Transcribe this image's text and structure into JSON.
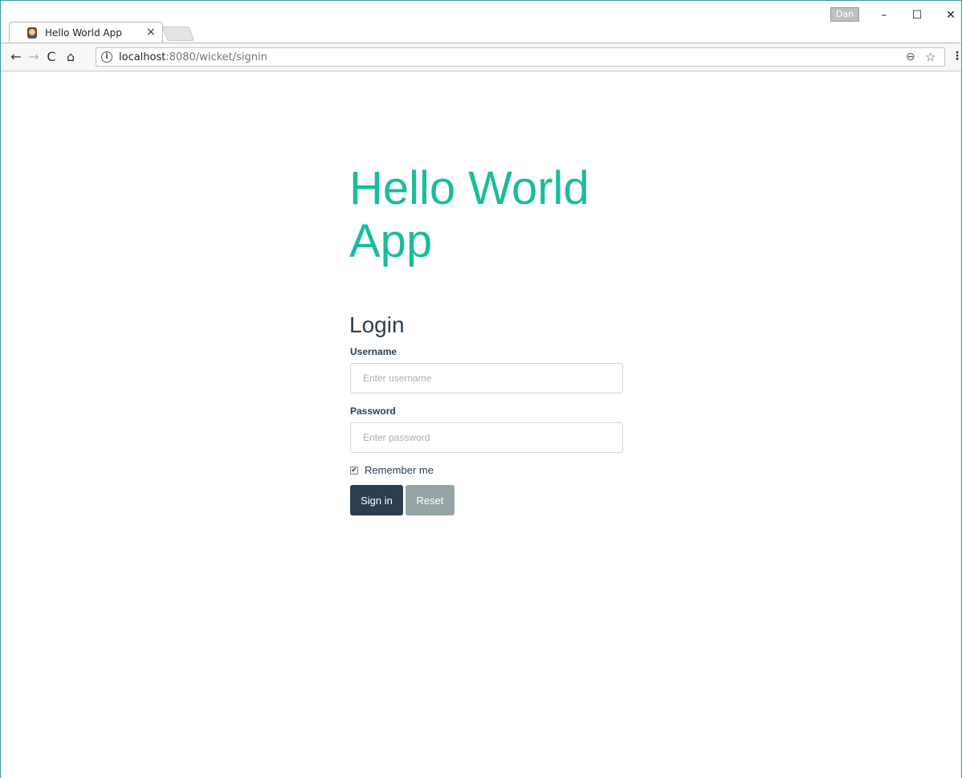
{
  "browser": {
    "tab_title": "Hello World App",
    "tab_close": "×",
    "profile_name": "Dan",
    "window_controls": {
      "minimize": "–",
      "maximize": "☐",
      "close": "✕"
    },
    "nav": {
      "back": "←",
      "forward": "→",
      "reload": "C",
      "home": "⌂"
    },
    "url_host": "localhost",
    "url_rest": ":8080/wicket/signin",
    "info_icon": "i",
    "zoom_icon": "⊖",
    "star_icon": "☆",
    "menu_icon": "⋮"
  },
  "page": {
    "app_title": "Hello World App",
    "login_heading": "Login",
    "username": {
      "label": "Username",
      "placeholder": "Enter username",
      "value": ""
    },
    "password": {
      "label": "Password",
      "placeholder": "Enter password",
      "value": ""
    },
    "remember": {
      "label": "Remember me",
      "checked": true,
      "check_glyph": "✔"
    },
    "signin_label": "Sign in",
    "reset_label": "Reset"
  },
  "colors": {
    "accent_teal": "#1abc9c",
    "primary_dark": "#2c3e50",
    "reset_gray": "#95a5a6"
  }
}
